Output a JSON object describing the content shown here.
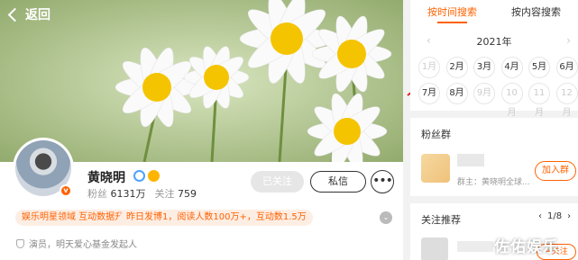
{
  "header": {
    "back_label": "返回"
  },
  "profile": {
    "name": "黄晓明",
    "fans_label": "粉丝",
    "fans_value": "6131万",
    "follow_label": "关注",
    "follow_value": "759",
    "tags": [
      "娱乐明星领域 互动数据升",
      "昨日发博1，阅读人数100万+，互动数1.5万"
    ],
    "bio": "演员，明天爱心基金发起人"
  },
  "actions": {
    "followed_label": "已关注",
    "message_label": "私信",
    "more_label": "•••"
  },
  "search": {
    "tabs": [
      {
        "label": "按时间搜索",
        "active": true
      },
      {
        "label": "按内容搜索",
        "active": false
      }
    ],
    "year": "2021年",
    "prev": "‹",
    "next": "›",
    "months": [
      {
        "label": "1月",
        "enabled": false
      },
      {
        "label": "2月",
        "enabled": true
      },
      {
        "label": "3月",
        "enabled": true
      },
      {
        "label": "4月",
        "enabled": true
      },
      {
        "label": "5月",
        "enabled": true
      },
      {
        "label": "6月",
        "enabled": true
      },
      {
        "label": "7月",
        "enabled": true
      },
      {
        "label": "8月",
        "enabled": true
      },
      {
        "label": "9月",
        "enabled": false
      },
      {
        "label": "10月",
        "enabled": false
      },
      {
        "label": "11月",
        "enabled": false
      },
      {
        "label": "12月",
        "enabled": false
      }
    ]
  },
  "fans_group": {
    "title": "粉丝群",
    "owner": "群主：黄晓明全球...",
    "join_label": "加入群"
  },
  "recommend": {
    "title": "关注推荐",
    "prev": "‹",
    "page": "1/8",
    "next": "›",
    "follow_label": "+关注"
  },
  "watermark": "佐佑娱乐",
  "colors": {
    "accent": "#ff6200",
    "tag_bg": "#fdeee4",
    "annotation_arrow": "#e02020"
  }
}
